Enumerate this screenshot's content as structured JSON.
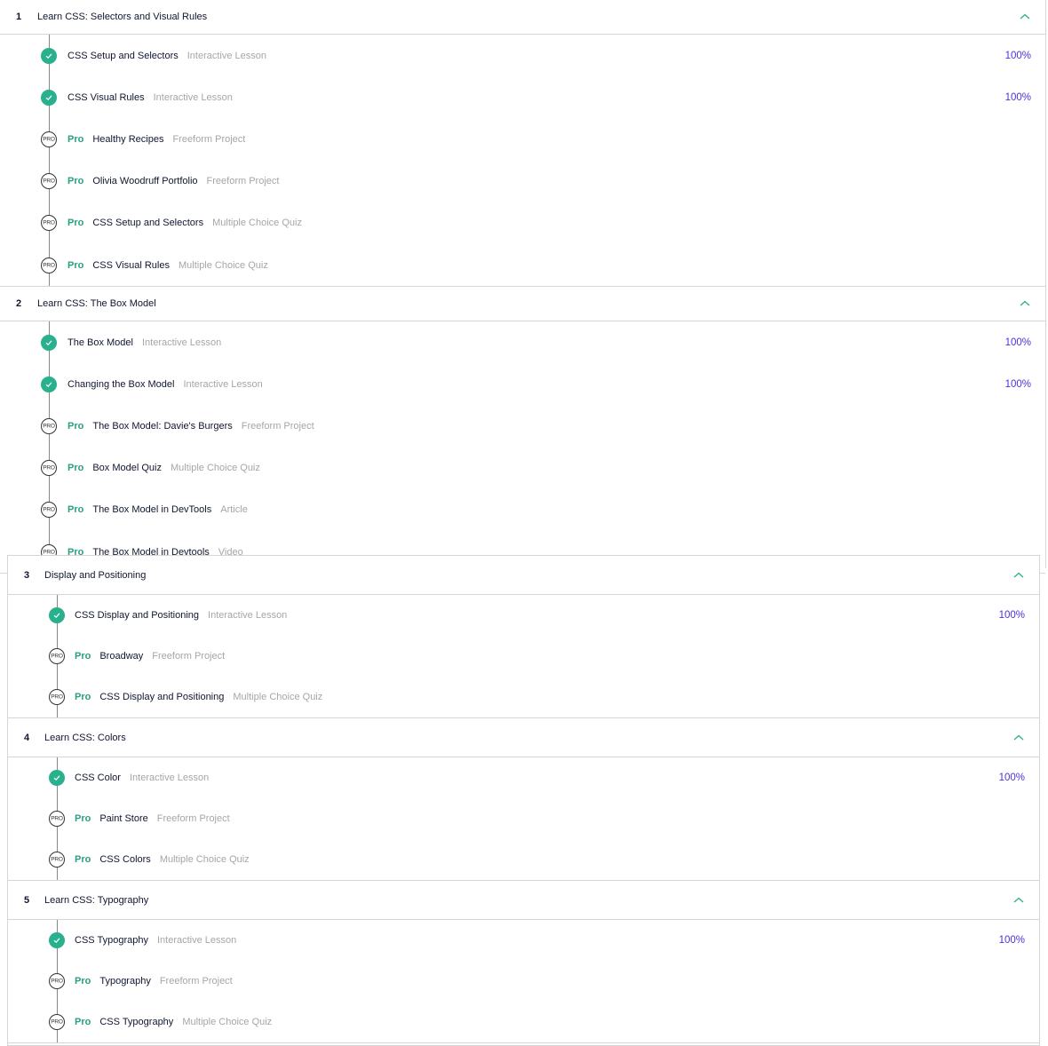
{
  "colors": {
    "accent": "#29b08c",
    "percent": "#4a32e0",
    "pro": "#29a083",
    "muted": "#a6a6a6"
  },
  "panel_top": {
    "sections": [
      {
        "number": "1",
        "title": "Learn CSS: Selectors and Visual Rules",
        "items": [
          {
            "status": "done",
            "pro": "",
            "name": "CSS Setup and Selectors",
            "type": "Interactive Lesson",
            "percent": "100%"
          },
          {
            "status": "done",
            "pro": "",
            "name": "CSS Visual Rules",
            "type": "Interactive Lesson",
            "percent": "100%"
          },
          {
            "status": "pro",
            "pro": "Pro",
            "name": "Healthy Recipes",
            "type": "Freeform Project",
            "percent": ""
          },
          {
            "status": "pro",
            "pro": "Pro",
            "name": "Olivia Woodruff Portfolio",
            "type": "Freeform Project",
            "percent": ""
          },
          {
            "status": "pro",
            "pro": "Pro",
            "name": "CSS Setup and Selectors",
            "type": "Multiple Choice Quiz",
            "percent": ""
          },
          {
            "status": "pro",
            "pro": "Pro",
            "name": "CSS Visual Rules",
            "type": "Multiple Choice Quiz",
            "percent": ""
          }
        ]
      },
      {
        "number": "2",
        "title": "Learn CSS: The Box Model",
        "items": [
          {
            "status": "done",
            "pro": "",
            "name": "The Box Model",
            "type": "Interactive Lesson",
            "percent": "100%"
          },
          {
            "status": "done",
            "pro": "",
            "name": "Changing the Box Model",
            "type": "Interactive Lesson",
            "percent": "100%"
          },
          {
            "status": "pro",
            "pro": "Pro",
            "name": "The Box Model: Davie's Burgers",
            "type": "Freeform Project",
            "percent": ""
          },
          {
            "status": "pro",
            "pro": "Pro",
            "name": "Box Model Quiz",
            "type": "Multiple Choice Quiz",
            "percent": ""
          },
          {
            "status": "pro",
            "pro": "Pro",
            "name": "The Box Model in DevTools",
            "type": "Article",
            "percent": ""
          },
          {
            "status": "pro",
            "pro": "Pro",
            "name": "The Box Model in Devtools",
            "type": "Video",
            "percent": ""
          }
        ]
      }
    ]
  },
  "panel_bottom": {
    "sections": [
      {
        "number": "3",
        "title": "Display and Positioning",
        "items": [
          {
            "status": "done",
            "pro": "",
            "name": "CSS Display and Positioning",
            "type": "Interactive Lesson",
            "percent": "100%"
          },
          {
            "status": "pro",
            "pro": "Pro",
            "name": "Broadway",
            "type": "Freeform Project",
            "percent": ""
          },
          {
            "status": "pro",
            "pro": "Pro",
            "name": "CSS Display and Positioning",
            "type": "Multiple Choice Quiz",
            "percent": ""
          }
        ]
      },
      {
        "number": "4",
        "title": "Learn CSS: Colors",
        "items": [
          {
            "status": "done",
            "pro": "",
            "name": "CSS Color",
            "type": "Interactive Lesson",
            "percent": "100%"
          },
          {
            "status": "pro",
            "pro": "Pro",
            "name": "Paint Store",
            "type": "Freeform Project",
            "percent": ""
          },
          {
            "status": "pro",
            "pro": "Pro",
            "name": "CSS Colors",
            "type": "Multiple Choice Quiz",
            "percent": ""
          }
        ]
      },
      {
        "number": "5",
        "title": "Learn CSS: Typography",
        "items": [
          {
            "status": "done",
            "pro": "",
            "name": "CSS Typography",
            "type": "Interactive Lesson",
            "percent": "100%"
          },
          {
            "status": "pro",
            "pro": "Pro",
            "name": "Typography",
            "type": "Freeform Project",
            "percent": ""
          },
          {
            "status": "pro",
            "pro": "Pro",
            "name": "CSS Typography",
            "type": "Multiple Choice Quiz",
            "percent": ""
          }
        ]
      }
    ]
  },
  "icons": {
    "done": "check-circle-icon",
    "pro": "pro-badge-icon",
    "collapse": "chevron-up-icon"
  },
  "pro_badge_text": "PRO"
}
